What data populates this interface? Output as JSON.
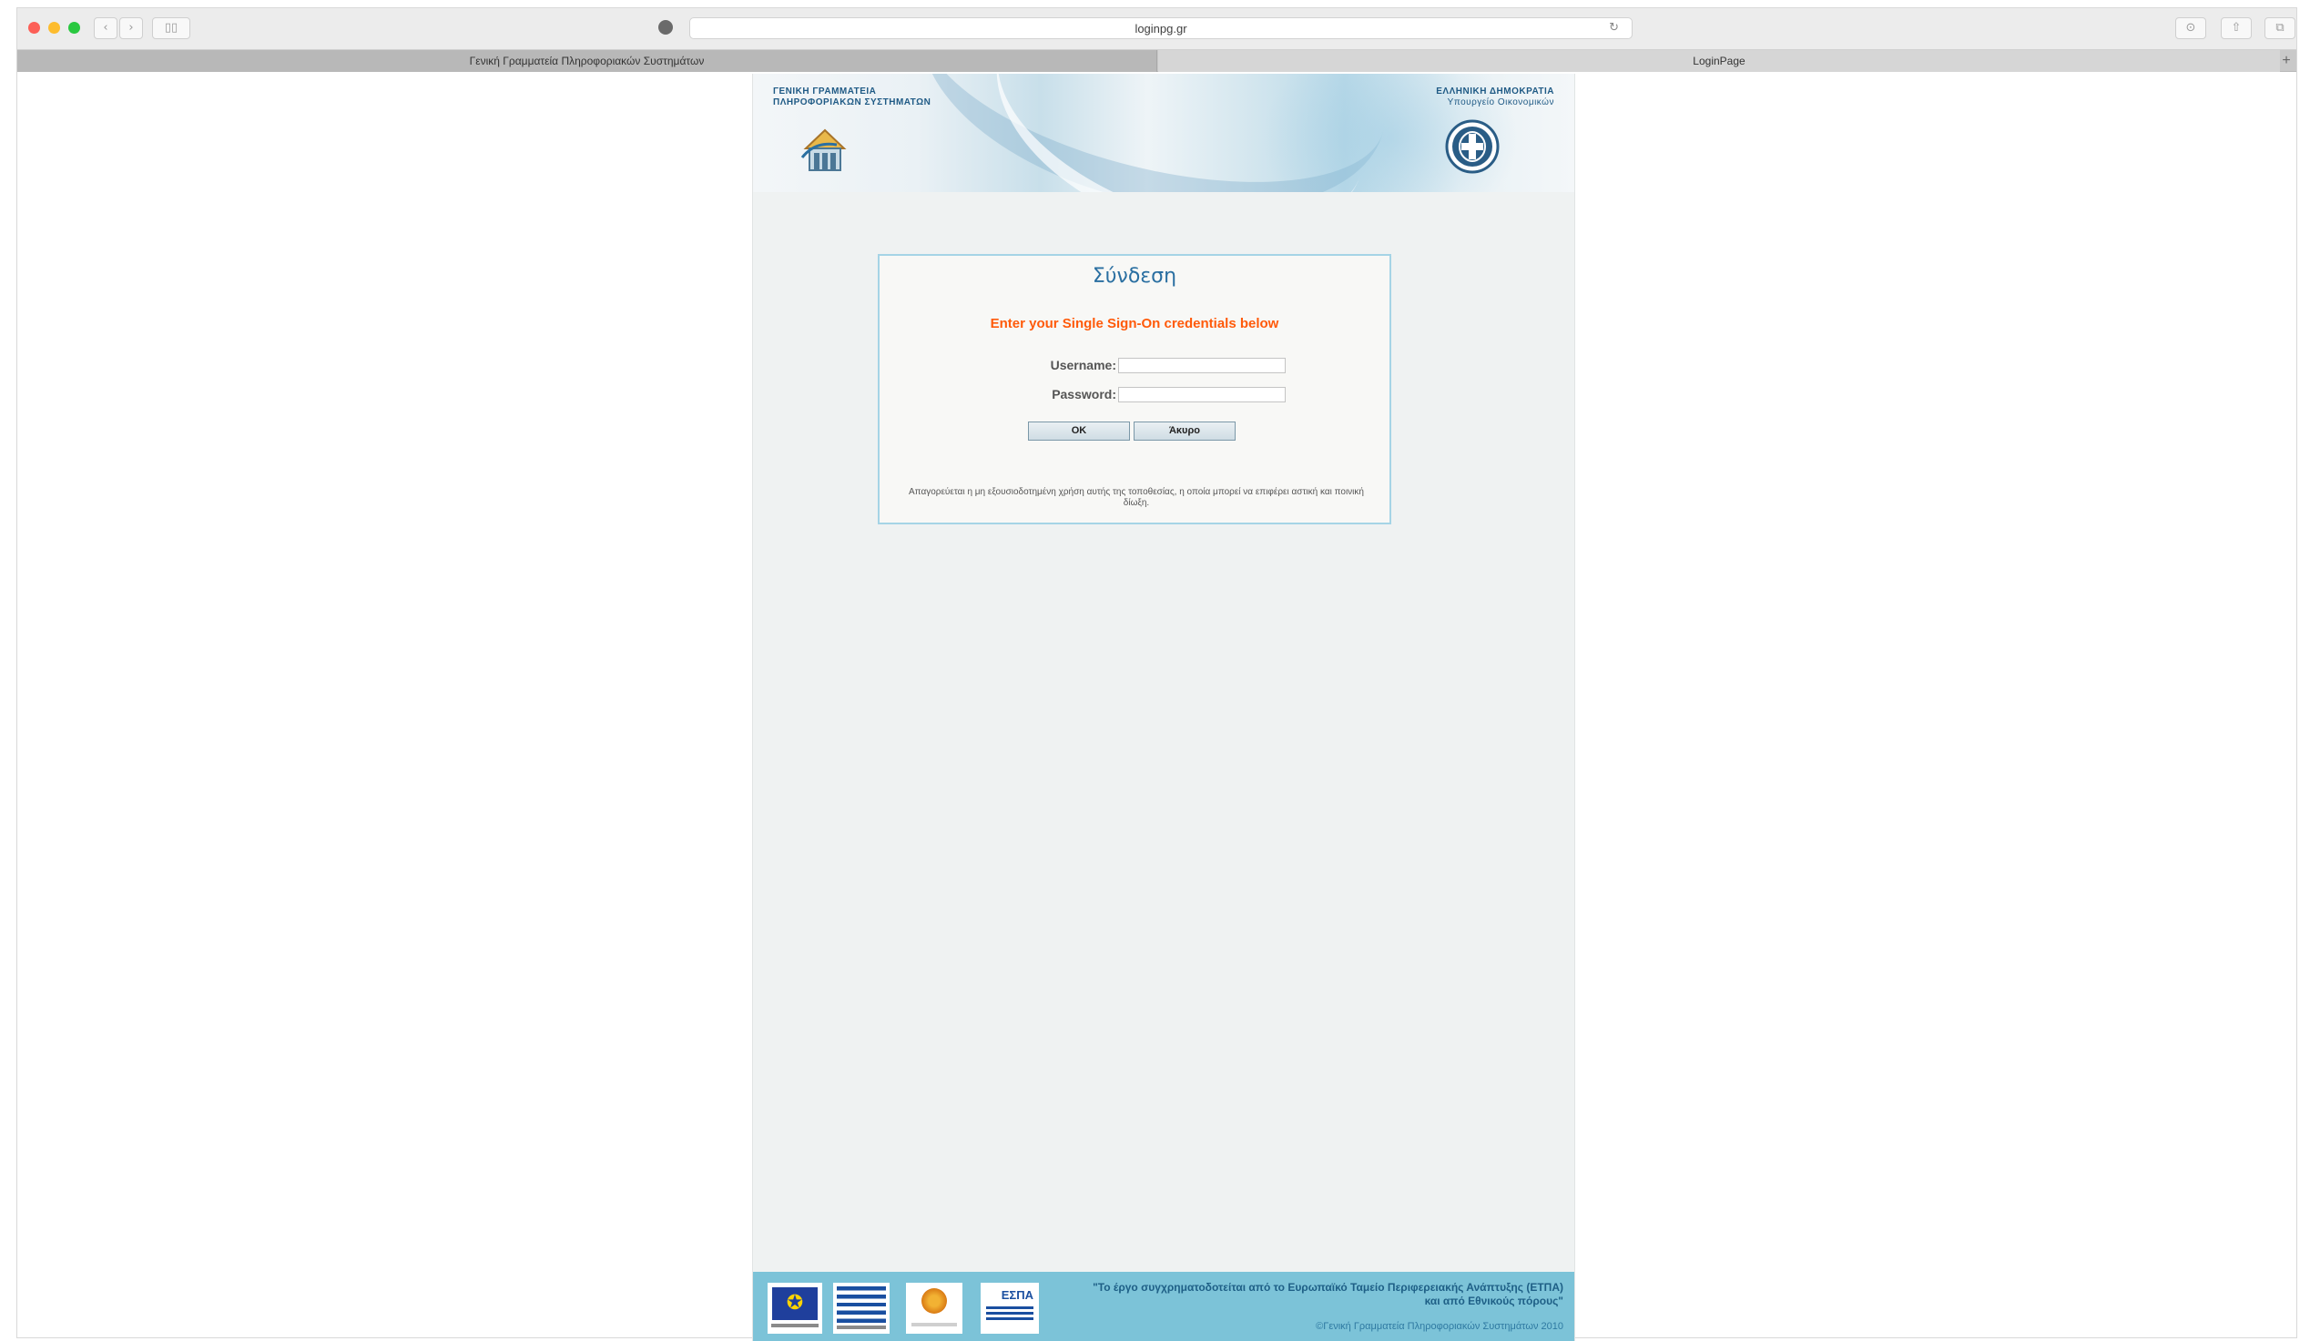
{
  "browser": {
    "url": "loginpg.gr",
    "back_icon": "‹",
    "forward_icon": "›",
    "sidebar_icon": "▯▯",
    "reload_icon": "↻",
    "download_icon": "⊙",
    "share_icon": "⇧",
    "tabs_icon": "⧉",
    "new_tab_icon": "+",
    "tabs": [
      {
        "label": "Γενική Γραμματεία Πληροφοριακών Συστημάτων"
      },
      {
        "label": "LoginPage"
      }
    ]
  },
  "banner": {
    "left_line1": "ΓΕΝΙΚΗ ΓΡΑΜΜΑΤΕΙΑ",
    "left_line2": "ΠΛΗΡΟΦΟΡΙΑΚΩΝ ΣΥΣΤΗΜΑΤΩΝ",
    "right_line1": "ΕΛΛΗΝΙΚΗ ΔΗΜΟΚΡΑΤΙΑ",
    "right_line2": "Υπουργείο Οικονομικών"
  },
  "login": {
    "title": "Σύνδεση",
    "subtitle": "Enter your Single Sign-On credentials below",
    "username_label": "Username:",
    "password_label": "Password:",
    "username_value": "",
    "password_value": "",
    "ok_label": "OK",
    "cancel_label": "Άκυρο",
    "warning": "Απαγορεύεται η μη εξουσιοδοτημένη χρήση αυτής της τοποθεσίας, η οποία μπορεί να επιφέρει αστική και ποινική δίωξη."
  },
  "footer": {
    "espa_mark": "ΕΣΠΑ",
    "quote_line1": "\"Το έργο συγχρηματοδοτείται από το Ευρωπαϊκό Ταμείο Περιφερειακής Ανάπτυξης (ΕΤΠΑ)",
    "quote_line2": "και από Εθνικούς πόρους\"",
    "copyright": "©Γενική Γραμματεία Πληροφοριακών Συστημάτων 2010"
  },
  "colors": {
    "accent_blue": "#2a6fa1",
    "subtitle_orange": "#ff5a0a",
    "footer_bg": "#7cc3d8",
    "login_border": "#a5d4e6"
  }
}
